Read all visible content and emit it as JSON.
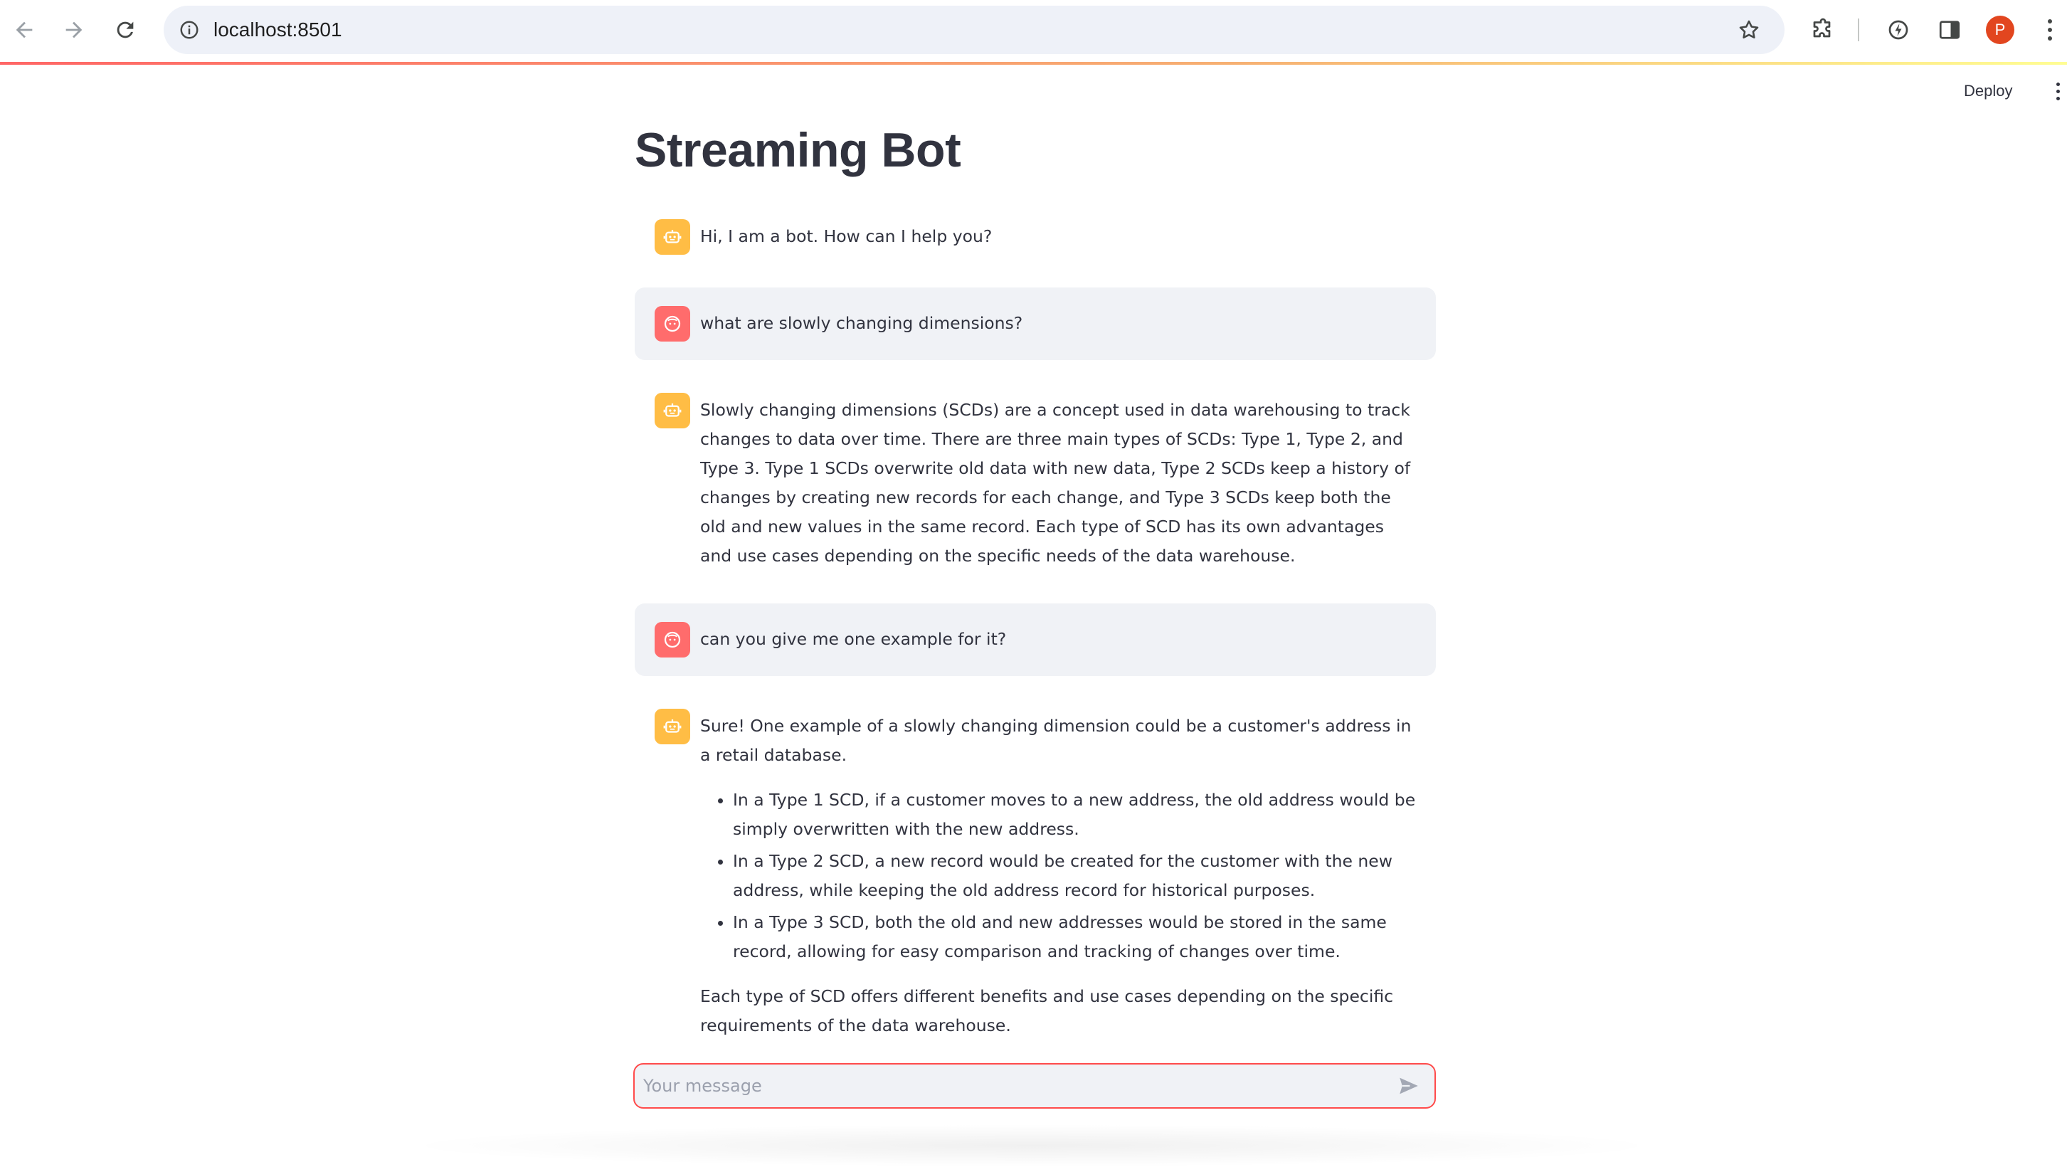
{
  "browser": {
    "url": "localhost:8501",
    "profile_initial": "P"
  },
  "app": {
    "deploy_label": "Deploy",
    "title": "Streaming Bot"
  },
  "colors": {
    "bot_avatar": "#ffbd45",
    "user_avatar": "#ff6c6c",
    "user_bubble": "#f0f2f6",
    "input_border": "#ff4b4b"
  },
  "messages": [
    {
      "role": "bot",
      "paragraphs": [
        "Hi, I am a bot. How can I help you?"
      ]
    },
    {
      "role": "user",
      "paragraphs": [
        "what are slowly changing dimensions?"
      ]
    },
    {
      "role": "bot",
      "paragraphs": [
        "Slowly changing dimensions (SCDs) are a concept used in data warehousing to track changes to data over time. There are three main types of SCDs: Type 1, Type 2, and Type 3. Type 1 SCDs overwrite old data with new data, Type 2 SCDs keep a history of changes by creating new records for each change, and Type 3 SCDs keep both the old and new values in the same record. Each type of SCD has its own advantages and use cases depending on the specific needs of the data warehouse."
      ]
    },
    {
      "role": "user",
      "paragraphs": [
        "can you give me one example for it?"
      ]
    },
    {
      "role": "bot",
      "intro": "Sure! One example of a slowly changing dimension could be a customer's address in a retail database.",
      "bullets": [
        "In a Type 1 SCD, if a customer moves to a new address, the old address would be simply overwritten with the new address.",
        "In a Type 2 SCD, a new record would be created for the customer with the new address, while keeping the old address record for historical purposes.",
        "In a Type 3 SCD, both the old and new addresses would be stored in the same record, allowing for easy comparison and tracking of changes over time."
      ],
      "outro": "Each type of SCD offers different benefits and use cases depending on the specific requirements of the data warehouse."
    }
  ],
  "chat_input": {
    "placeholder": "Your message",
    "value": ""
  }
}
